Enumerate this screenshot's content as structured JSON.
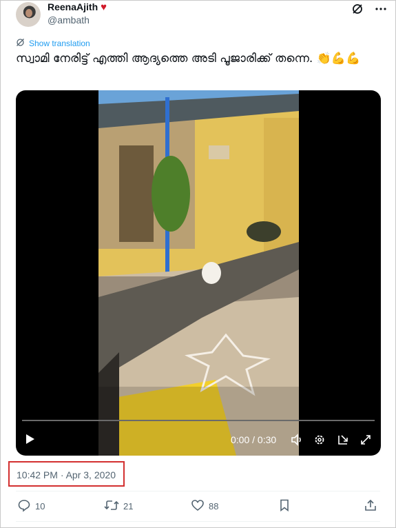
{
  "author": {
    "display_name": "ReenaAjith",
    "heart_emoji": "♥",
    "handle": "@ambath",
    "avatar_icon": "profile-photo"
  },
  "translate": {
    "label": "Show translation",
    "icon": "translate-icon"
  },
  "tweet": {
    "text": "സ്വാമി നേരിട്ട് എത്തി ആദ്യത്തെ അടി പൂജാരിക്ക് തന്നെ. 👏💪💪"
  },
  "video": {
    "time_display": "0:00 / 0:30",
    "progress": 0
  },
  "timestamp": "10:42 PM · Apr 3, 2020",
  "actions": {
    "reply_count": "10",
    "retweet_count": "21",
    "like_count": "88"
  },
  "colors": {
    "accent": "#1d9bf0",
    "highlight": "#d32f2f",
    "muted": "#536471"
  }
}
